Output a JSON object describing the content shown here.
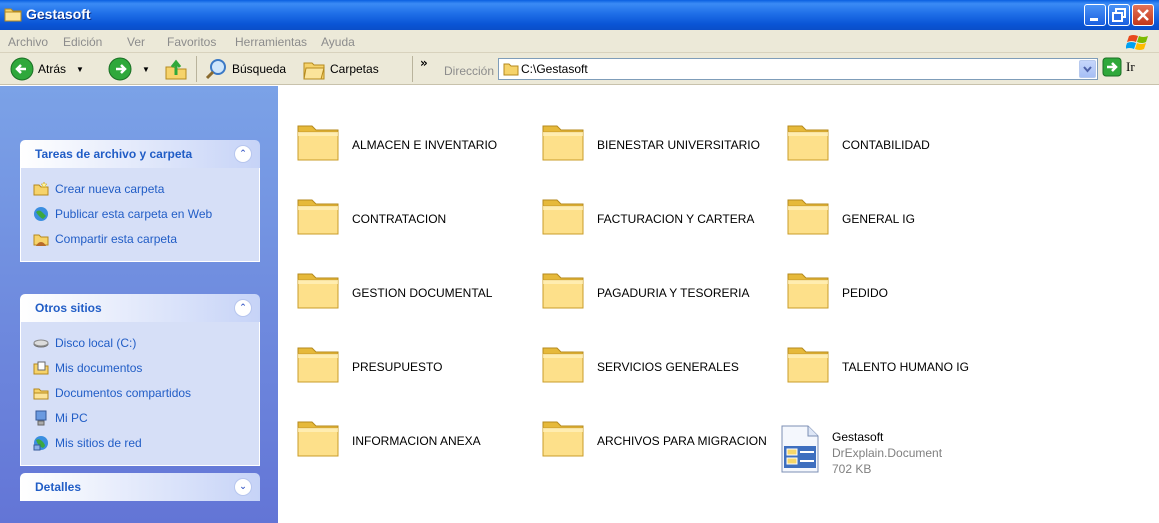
{
  "window": {
    "title": "Gestasoft"
  },
  "menu": [
    "Archivo",
    "Edición",
    "Ver",
    "Favoritos",
    "Herramientas",
    "Ayuda"
  ],
  "toolbar": {
    "back_label": "Atrás",
    "search_label": "Búsqueda",
    "folders_label": "Carpetas",
    "more": "»",
    "address_label": "Dirección",
    "address_value": "C:\\Gestasoft",
    "go_label": "Ir"
  },
  "left_panel": {
    "tasks": {
      "title": "Tareas de archivo y carpeta",
      "items": [
        "Crear nueva carpeta",
        "Publicar esta carpeta en Web",
        "Compartir esta carpeta"
      ]
    },
    "other_places": {
      "title": "Otros sitios",
      "items": [
        "Disco local (C:)",
        "Mis documentos",
        "Documentos compartidos",
        "Mi PC",
        "Mis sitios de red"
      ]
    },
    "details": {
      "title": "Detalles"
    }
  },
  "files": [
    {
      "name": "ALMACEN E INVENTARIO"
    },
    {
      "name": "BIENESTAR UNIVERSITARIO"
    },
    {
      "name": "CONTABILIDAD"
    },
    {
      "name": "CONTRATACION"
    },
    {
      "name": "FACTURACION Y CARTERA"
    },
    {
      "name": "GENERAL IG"
    },
    {
      "name": "GESTION DOCUMENTAL"
    },
    {
      "name": "PAGADURIA Y TESORERIA"
    },
    {
      "name": "PEDIDO"
    },
    {
      "name": "PRESUPUESTO"
    },
    {
      "name": "SERVICIOS GENERALES"
    },
    {
      "name": "TALENTO HUMANO IG"
    },
    {
      "name": "INFORMACION ANEXA"
    },
    {
      "name": "ARCHIVOS PARA MIGRACION"
    }
  ],
  "document": {
    "name": "Gestasoft",
    "type": "DrExplain.Document",
    "size": "702 KB"
  }
}
